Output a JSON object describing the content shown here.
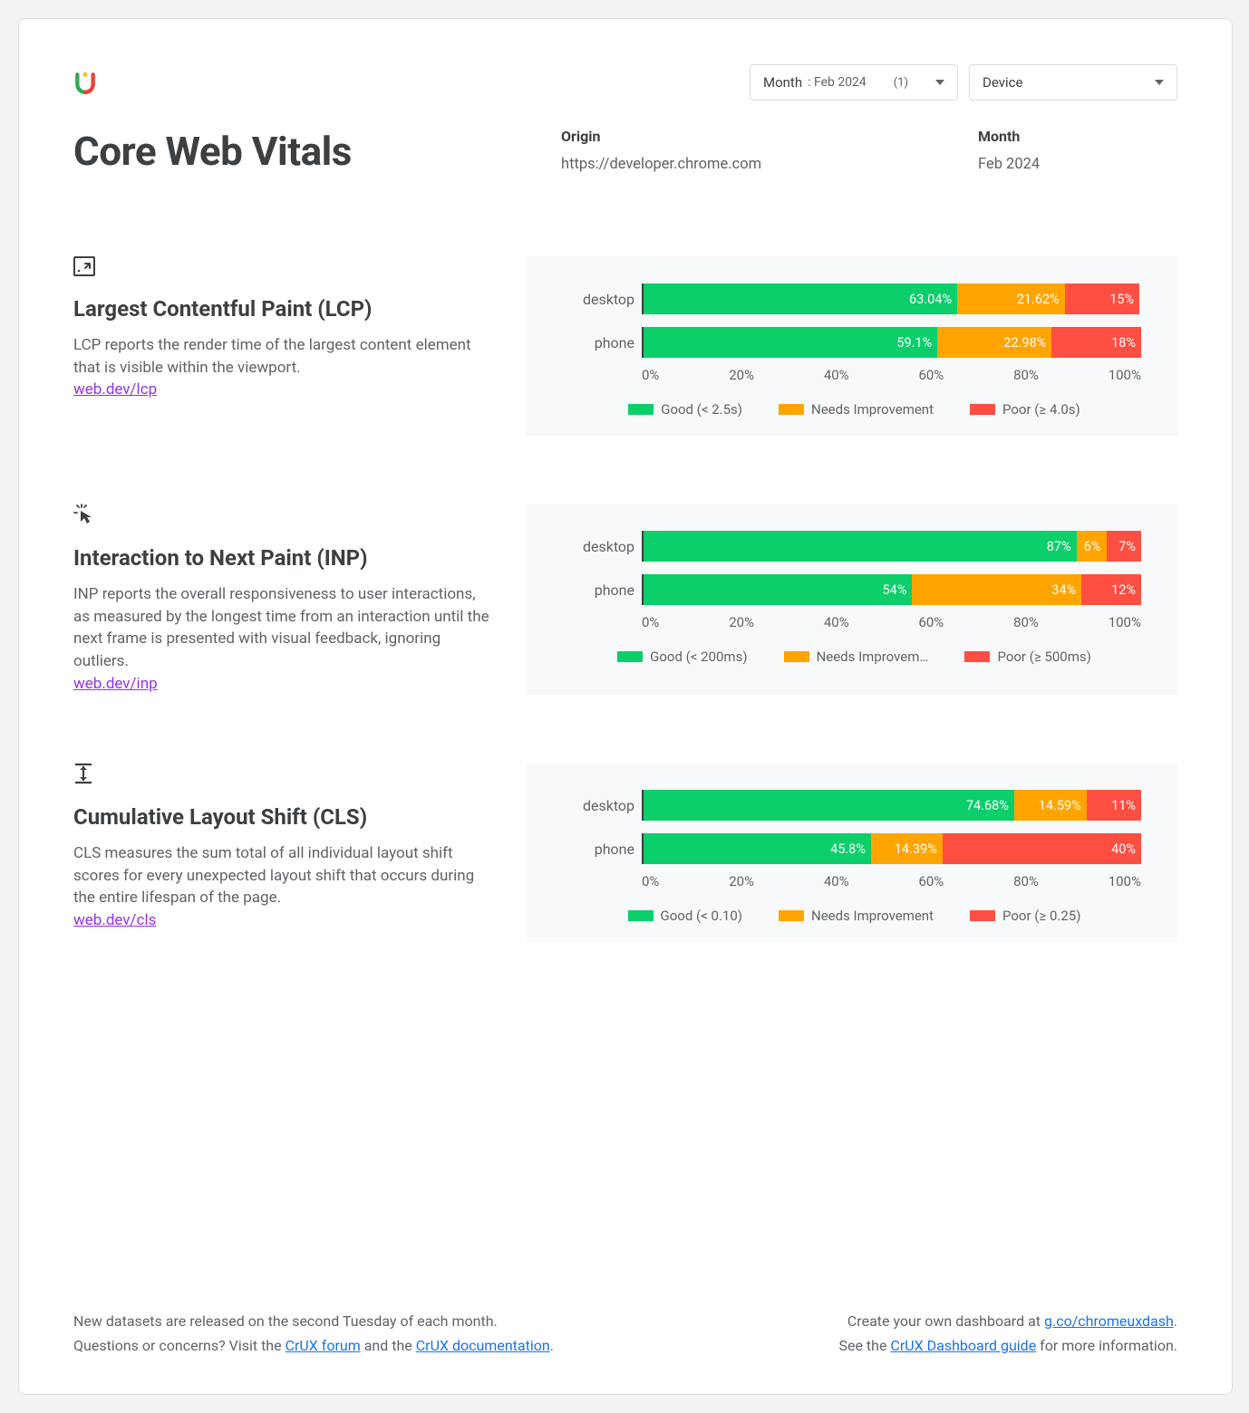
{
  "filters": {
    "month_label": "Month",
    "month_value": ": Feb 2024",
    "month_count": "(1)",
    "device_label": "Device"
  },
  "title": "Core Web Vitals",
  "origin_label": "Origin",
  "origin_value": "https://developer.chrome.com",
  "month_label": "Month",
  "month_value": "Feb 2024",
  "axis_ticks": [
    "0%",
    "20%",
    "40%",
    "60%",
    "80%",
    "100%"
  ],
  "colors": {
    "good": "#0cce6b",
    "ni": "#ffa400",
    "poor": "#ff4e42"
  },
  "metrics": [
    {
      "id": "lcp",
      "title": "Largest Contentful Paint (LCP)",
      "desc": "LCP reports the render time of the largest content element that is visible within the viewport.",
      "link": "web.dev/lcp",
      "legend": {
        "good": "Good (< 2.5s)",
        "ni": "Needs Improvement",
        "poor": "Poor (≥ 4.0s)"
      }
    },
    {
      "id": "inp",
      "title": "Interaction to Next Paint (INP)",
      "desc": "INP reports the overall responsiveness to user interactions, as measured by the longest time from an interaction until the next frame is presented with visual feedback, ignoring outliers.",
      "link": "web.dev/inp",
      "legend": {
        "good": "Good (< 200ms)",
        "ni": "Needs Improvem…",
        "poor": "Poor (≥ 500ms)"
      }
    },
    {
      "id": "cls",
      "title": "Cumulative Layout Shift (CLS)",
      "desc": "CLS measures the sum total of all individual layout shift scores for every unexpected layout shift that occurs during the entire lifespan of the page.",
      "link": "web.dev/cls",
      "legend": {
        "good": "Good (< 0.10)",
        "ni": "Needs Improvement",
        "poor": "Poor (≥ 0.25)"
      }
    }
  ],
  "chart_data": [
    {
      "metric": "lcp",
      "type": "bar",
      "categories": [
        "desktop",
        "phone"
      ],
      "series": [
        {
          "name": "Good",
          "values": [
            63.04,
            59.1
          ],
          "labels": [
            "63.04%",
            "59.1%"
          ]
        },
        {
          "name": "Needs Improvement",
          "values": [
            21.62,
            22.98
          ],
          "labels": [
            "21.62%",
            "22.98%"
          ]
        },
        {
          "name": "Poor",
          "values": [
            15,
            18
          ],
          "labels": [
            "15%",
            "18%"
          ]
        }
      ],
      "xlabel": "",
      "ylabel": "%",
      "xlim": [
        0,
        100
      ]
    },
    {
      "metric": "inp",
      "type": "bar",
      "categories": [
        "desktop",
        "phone"
      ],
      "series": [
        {
          "name": "Good",
          "values": [
            87,
            54
          ],
          "labels": [
            "87%",
            "54%"
          ]
        },
        {
          "name": "Needs Improvement",
          "values": [
            6,
            34
          ],
          "labels": [
            "6%",
            "34%"
          ]
        },
        {
          "name": "Poor",
          "values": [
            7,
            12
          ],
          "labels": [
            "7%",
            "12%"
          ]
        }
      ],
      "xlabel": "",
      "ylabel": "%",
      "xlim": [
        0,
        100
      ]
    },
    {
      "metric": "cls",
      "type": "bar",
      "categories": [
        "desktop",
        "phone"
      ],
      "series": [
        {
          "name": "Good",
          "values": [
            74.68,
            45.8
          ],
          "labels": [
            "74.68%",
            "45.8%"
          ]
        },
        {
          "name": "Needs Improvement",
          "values": [
            14.59,
            14.39
          ],
          "labels": [
            "14.59%",
            "14.39%"
          ]
        },
        {
          "name": "Poor",
          "values": [
            11,
            40
          ],
          "labels": [
            "11%",
            "40%"
          ]
        }
      ],
      "xlabel": "",
      "ylabel": "%",
      "xlim": [
        0,
        100
      ]
    }
  ],
  "footer": {
    "left1a": "New datasets are released on the second Tuesday of each month.",
    "left2a": "Questions or concerns? Visit the ",
    "left2_link1": "CrUX forum",
    "left2b": " and the ",
    "left2_link2": "CrUX documentation",
    "left2c": ".",
    "right1a": "Create your own dashboard at ",
    "right1_link": "g.co/chromeuxdash",
    "right1b": ".",
    "right2a": "See the ",
    "right2_link": "CrUX Dashboard guide",
    "right2b": " for more information."
  }
}
